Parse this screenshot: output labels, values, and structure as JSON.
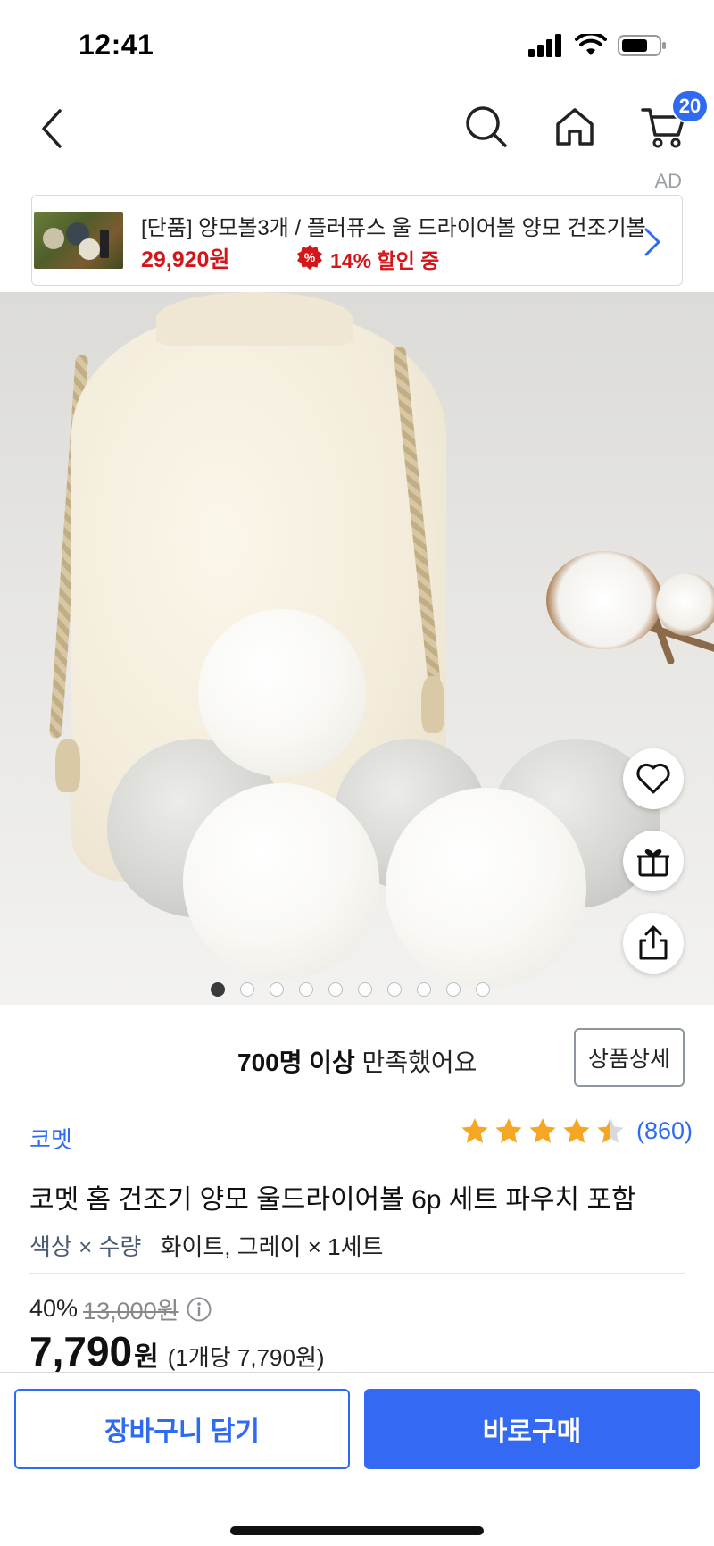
{
  "status_bar": {
    "time": "12:41"
  },
  "nav": {
    "back_icon": "chevron-left-icon",
    "search_icon": "search-icon",
    "home_icon": "home-icon",
    "cart_icon": "cart-icon",
    "cart_count": "20"
  },
  "ad": {
    "label": "AD",
    "title": "[단품] 양모볼3개 / 플러퓨스 울 드라이어볼 양모 건조기볼",
    "price": "29,920원",
    "discount": "14% 할인 중"
  },
  "image": {
    "total_slides": 10,
    "current_slide": 1,
    "actions": [
      "heart-icon",
      "gift-icon",
      "share-icon"
    ]
  },
  "satisfaction": {
    "highlight": "700명 이상",
    "rest": " 만족했어요",
    "detail_button": "상품상세"
  },
  "product": {
    "brand": "코멧",
    "rating_value": 4.5,
    "rating_count": "(860)",
    "title": "코멧 홈 건조기 양모 울드라이어볼 6p 세트 파우치 포함",
    "option_label": "색상 × 수량",
    "option_value": "화이트, 그레이 × 1세트",
    "discount_pct": "40%",
    "original_price": "13,000원",
    "price": "7,790",
    "price_unit": "원",
    "unit_price": "(1개당 7,790원)"
  },
  "bottom": {
    "cart_button": "장바구니 담기",
    "buy_button": "바로구매"
  },
  "colors": {
    "accent": "#2f6bf2",
    "sale_red": "#d4161a",
    "star": "#f5a623"
  }
}
